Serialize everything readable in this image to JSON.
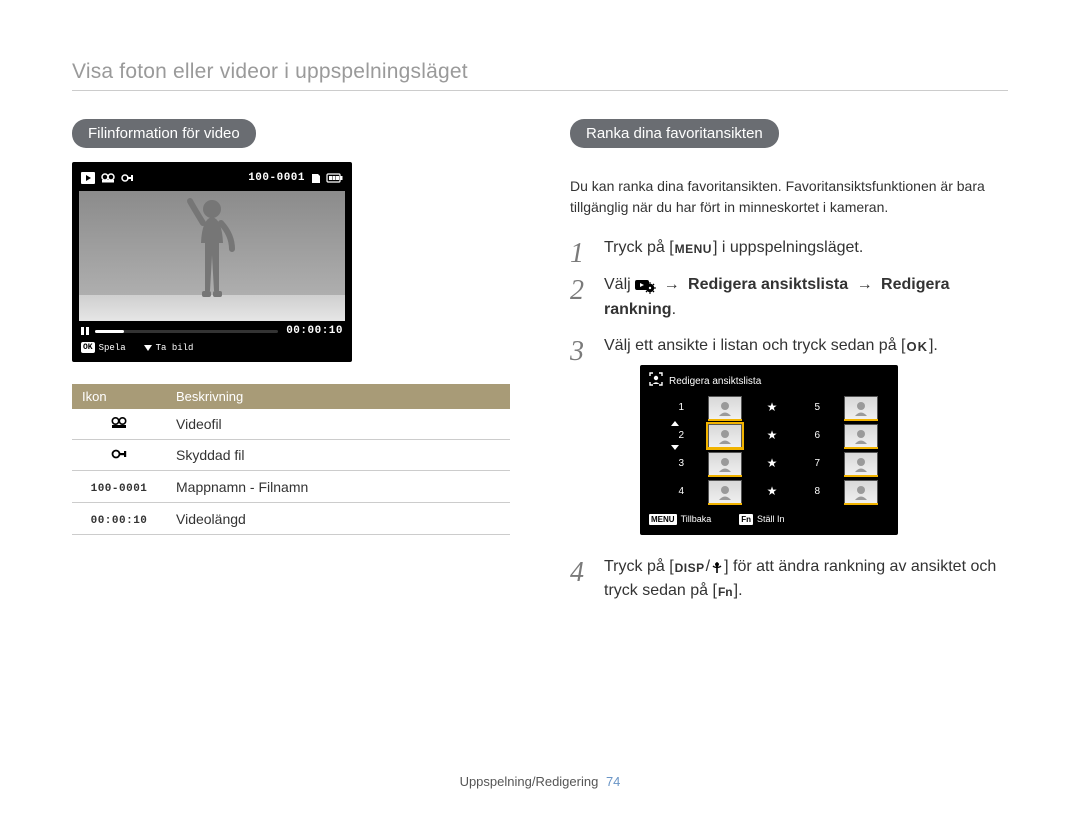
{
  "header_title": "Visa foton eller videor i uppspelningsläget",
  "left": {
    "pill": "Filinformation för video",
    "lcd_top_filename": "100-0001",
    "lcd_time": "00:00:10",
    "lcd_play_label": "Spela",
    "lcd_capture_label": "Ta bild",
    "table_header_icon": "Ikon",
    "table_header_desc": "Beskrivning",
    "rows": [
      {
        "icon_name": "video-file-icon",
        "desc": "Videofil"
      },
      {
        "icon_name": "lock-icon",
        "desc": "Skyddad fil"
      },
      {
        "icon_text": "100-0001",
        "desc": "Mappnamn - Filnamn"
      },
      {
        "icon_text": "00:00:10",
        "desc": "Videolängd"
      }
    ]
  },
  "right": {
    "pill": "Ranka dina favoritansikten",
    "intro": "Du kan ranka dina favoritansikten. Favoritansiktsfunktionen är bara tillgänglig när du har fört in minneskortet i kameran.",
    "step1_before": "Tryck på [",
    "step1_after": "] i uppspelningsläget.",
    "step2_prefix": "Välj ",
    "step2_item1": "Redigera ansiktslista",
    "step2_item2": "Redigera rankning",
    "step2_period": ".",
    "step3_before": "Välj ett ansikte i listan och tryck sedan på [",
    "step3_after": "].",
    "step4_a": "Tryck på [",
    "step4_b": "] för att ändra rankning av ansiktet och tryck sedan på [",
    "step4_c": "].",
    "mini": {
      "title": "Redigera ansiktslista",
      "back": "Tillbaka",
      "set": "Ställ In",
      "left_nums": [
        "1",
        "2",
        "3",
        "4"
      ],
      "right_nums": [
        "5",
        "6",
        "7",
        "8"
      ]
    }
  },
  "footer": {
    "section": "Uppspelning/Redigering",
    "page": "74"
  }
}
